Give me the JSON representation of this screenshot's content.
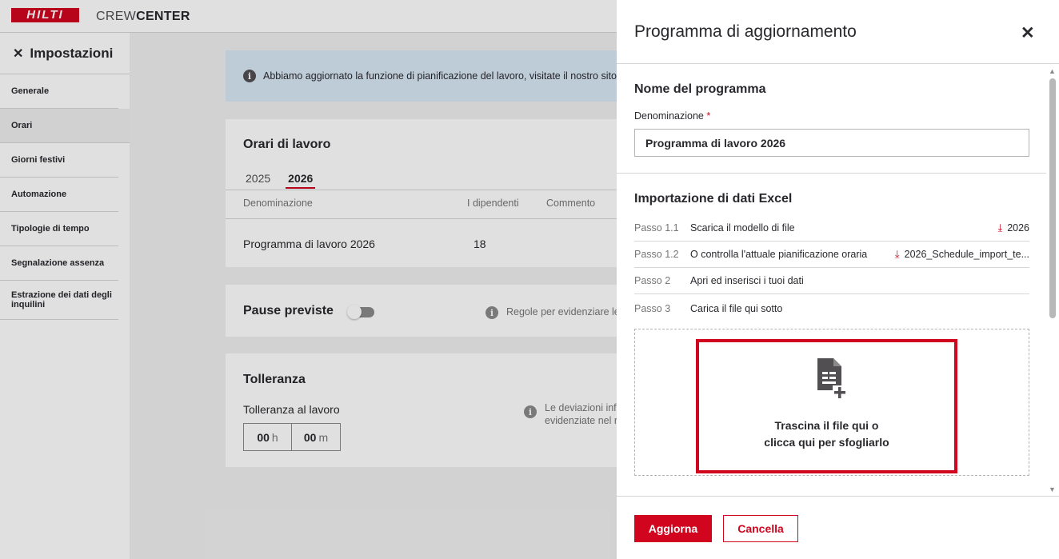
{
  "header": {
    "logo": "HILTI",
    "app_name_light": "CREW",
    "app_name_bold": "CENTER"
  },
  "sidebar": {
    "title": "Impostazioni",
    "items": [
      {
        "label": "Generale",
        "active": false
      },
      {
        "label": "Orari",
        "active": true
      },
      {
        "label": "Giorni festivi",
        "active": false
      },
      {
        "label": "Automazione",
        "active": false
      },
      {
        "label": "Tipologie di tempo",
        "active": false
      },
      {
        "label": "Segnalazione assenza",
        "active": false
      },
      {
        "label": "Estrazione dei dati degli inquilini",
        "active": false
      }
    ]
  },
  "main": {
    "banner": "Abbiamo aggiornato la funzione di pianificazione del lavoro, visitate il nostro sito",
    "work_hours": {
      "title": "Orari di lavoro",
      "tabs": [
        "2025",
        "2026"
      ],
      "active_tab": "2026",
      "columns": [
        "Denominazione",
        "I dipendenti",
        "Commento"
      ],
      "rows": [
        {
          "name": "Programma di lavoro 2026",
          "employees": "18",
          "comment": ""
        }
      ]
    },
    "breaks": {
      "title": "Pause previste",
      "info": "Regole per evidenziare le"
    },
    "tolerance": {
      "title": "Tolleranza",
      "label": "Tolleranza al lavoro",
      "hours": "00",
      "hours_unit": "h",
      "minutes": "00",
      "minutes_unit": "m",
      "info_line1": "Le deviazioni inf",
      "info_line2": "evidenziate nel r"
    }
  },
  "panel": {
    "title": "Programma di aggiornamento",
    "name_section": {
      "title": "Nome del programma",
      "label": "Denominazione",
      "required_mark": "*",
      "value": "Programma di lavoro 2026"
    },
    "import_section": {
      "title": "Importazione di dati Excel",
      "steps": [
        {
          "num": "Passo 1.1",
          "text": "Scarica il modello di file",
          "link": "2026"
        },
        {
          "num": "Passo 1.2",
          "text": "O controlla l'attuale pianificazione oraria",
          "link": "2026_Schedule_import_te..."
        },
        {
          "num": "Passo 2",
          "text": "Apri ed inserisci i tuoi dati",
          "link": ""
        },
        {
          "num": "Passo 3",
          "text": "Carica il file qui sotto",
          "link": ""
        }
      ],
      "dropzone_line1": "Trascina il file qui o",
      "dropzone_line2": "clicca qui per sfogliarlo"
    },
    "buttons": {
      "primary": "Aggiorna",
      "secondary": "Cancella"
    }
  },
  "colors": {
    "brand": "#d2051e",
    "banner": "#d9e9f6",
    "text": "#28282d"
  }
}
